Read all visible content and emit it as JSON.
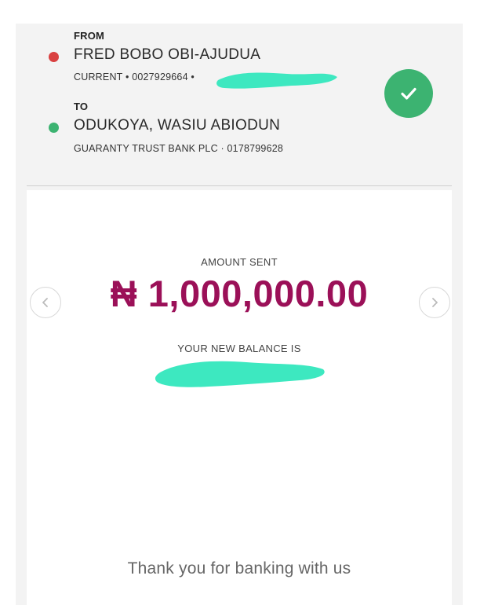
{
  "transfer": {
    "from_label": "FROM",
    "from_name": "FRED BOBO OBI-AJUDUA",
    "from_account": "CURRENT • 0027929664 •",
    "to_label": "TO",
    "to_name": "ODUKOYA, WASIU ABIODUN",
    "to_account": "GUARANTY TRUST BANK PLC · 0178799628",
    "status_icon": "check-icon"
  },
  "receipt": {
    "amount_label": "AMOUNT SENT",
    "amount_value": "₦ 1,000,000.00",
    "balance_label": "YOUR NEW BALANCE IS",
    "thanks": "Thank you for banking with us"
  },
  "nav": {
    "prev_icon": "chevron-left-icon",
    "next_icon": "chevron-right-icon"
  },
  "colors": {
    "from_dot": "#d94040",
    "to_dot": "#3cb371",
    "success": "#3cb371",
    "amount": "#9b1058",
    "redaction": "#3de8c0"
  }
}
